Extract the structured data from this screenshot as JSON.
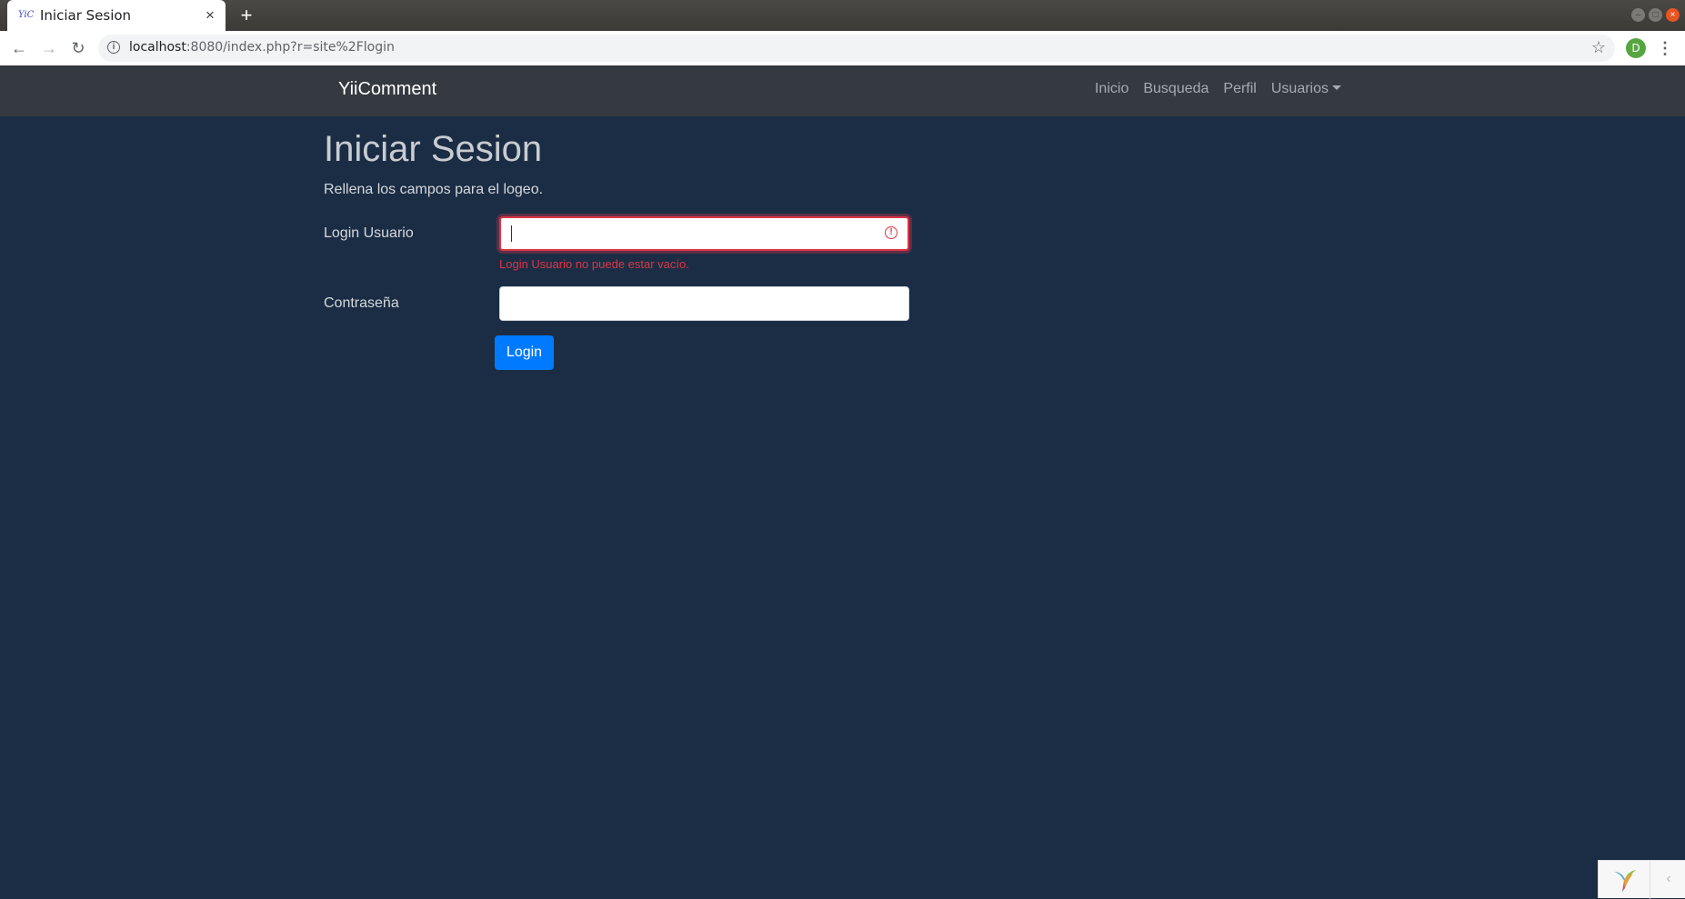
{
  "browser": {
    "tab_title": "Iniciar Sesion",
    "favicon_text": "YiC",
    "tab_close": "×",
    "new_tab": "+",
    "url_host": "localhost",
    "url_rest": ":8080/index.php?r=site%2Flogin",
    "profile_initial": "D"
  },
  "navbar": {
    "brand": "YiiComment",
    "links": [
      "Inicio",
      "Busqueda",
      "Perfil",
      "Usuarios"
    ]
  },
  "page": {
    "title": "Iniciar Sesion",
    "subtitle": "Rellena los campos para el logeo."
  },
  "form": {
    "username_label": "Login Usuario",
    "username_value": "",
    "username_error": "Login Usuario no puede estar vacío.",
    "password_label": "Contraseña",
    "password_value": "",
    "submit_label": "Login"
  },
  "colors": {
    "page_background": "#1b2d45",
    "navbar": "#343a40",
    "primary": "#007bff",
    "danger": "#dc3545"
  },
  "icons": {
    "back": "arrow-left-icon",
    "forward": "arrow-right-icon",
    "reload": "reload-icon",
    "info": "info-icon",
    "star": "star-icon",
    "menu": "kebab-menu-icon",
    "error": "exclamation-circle-icon",
    "debug_toggle": "chevron-left-icon"
  }
}
